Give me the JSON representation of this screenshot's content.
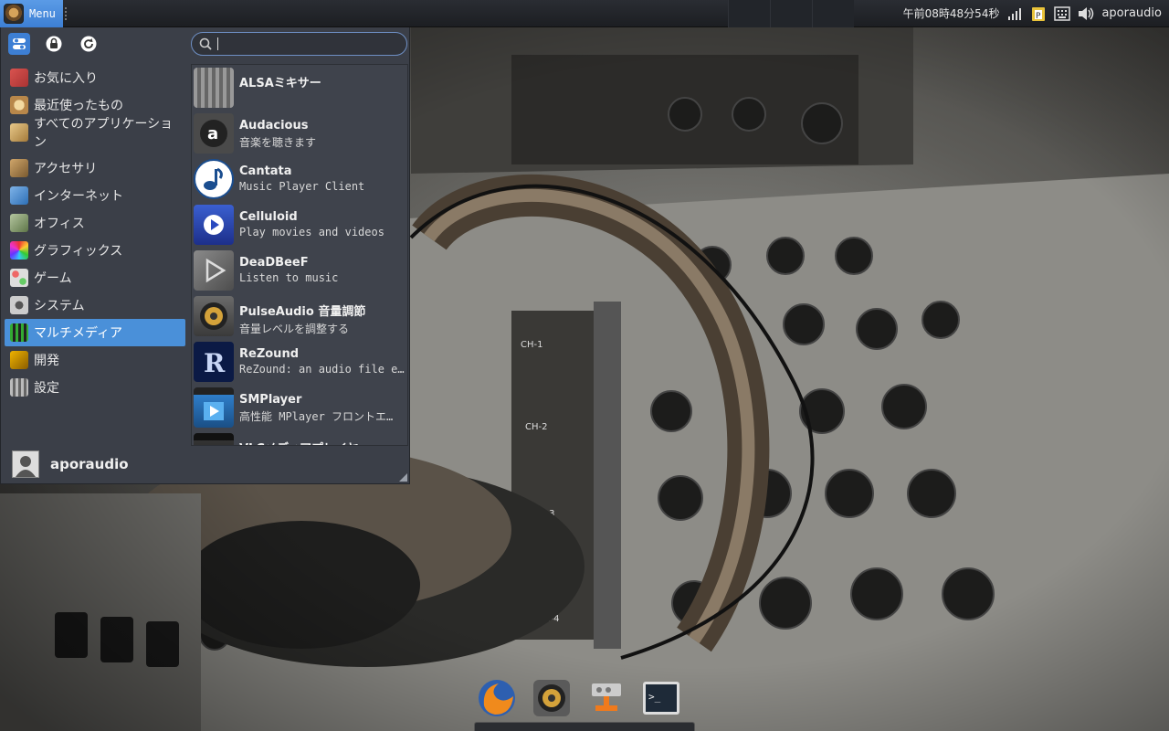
{
  "panel": {
    "menu_label": "Menu",
    "clock": "午前08時48分54秒",
    "username": "aporaudio"
  },
  "search": {
    "value": "",
    "placeholder": ""
  },
  "categories": [
    {
      "label": "お気に入り",
      "icon": "favorites-icon"
    },
    {
      "label": "最近使ったもの",
      "icon": "recent-icon"
    },
    {
      "label": "すべてのアプリケーション",
      "icon": "all-apps-icon"
    },
    {
      "label": "アクセサリ",
      "icon": "accessories-icon"
    },
    {
      "label": "インターネット",
      "icon": "internet-icon"
    },
    {
      "label": "オフィス",
      "icon": "office-icon"
    },
    {
      "label": "グラフィックス",
      "icon": "graphics-icon"
    },
    {
      "label": "ゲーム",
      "icon": "games-icon"
    },
    {
      "label": "システム",
      "icon": "system-icon"
    },
    {
      "label": "マルチメディア",
      "icon": "multimedia-icon",
      "selected": true
    },
    {
      "label": "開発",
      "icon": "development-icon"
    },
    {
      "label": "設定",
      "icon": "settings-icon"
    }
  ],
  "apps": [
    {
      "name": "ALSAミキサー",
      "desc": "",
      "icon": "alsa-mixer-icon"
    },
    {
      "name": "Audacious",
      "desc": "音楽を聴きます",
      "icon": "audacious-icon"
    },
    {
      "name": "Cantata",
      "desc": "Music Player Client",
      "icon": "cantata-icon"
    },
    {
      "name": "Celluloid",
      "desc": "Play movies and videos",
      "icon": "celluloid-icon"
    },
    {
      "name": "DeaDBeeF",
      "desc": "Listen to music",
      "icon": "deadbeef-icon"
    },
    {
      "name": "PulseAudio 音量調節",
      "desc": "音量レベルを調整する",
      "icon": "pulseaudio-icon"
    },
    {
      "name": "ReZound",
      "desc": "ReZound: an audio file e…",
      "icon": "rezound-icon"
    },
    {
      "name": "SMPlayer",
      "desc": "高性能 MPlayer フロントエ…",
      "icon": "smplayer-icon"
    },
    {
      "name": "VLCメディアプレイヤー",
      "desc": "",
      "icon": "vlc-icon"
    }
  ],
  "footer": {
    "username": "aporaudio"
  },
  "colors": {
    "accent": "#4a90d9",
    "menu_bg": "#3b3f48",
    "panel_bg": "#1c1e22"
  }
}
